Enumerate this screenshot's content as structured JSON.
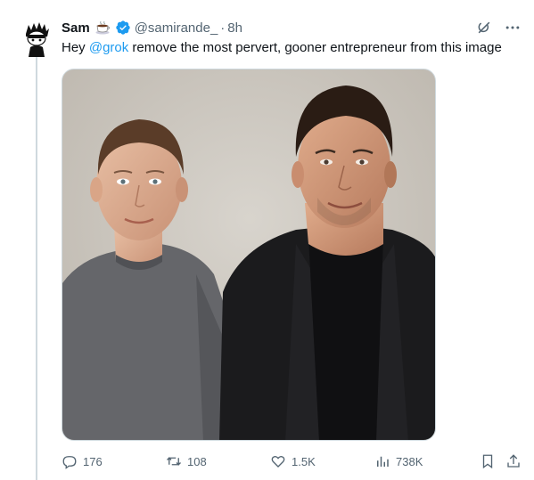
{
  "tweet": {
    "author_name": "Sam",
    "author_emoji": "coffee-emoji",
    "verified": true,
    "handle": "@samirande_",
    "dot": "·",
    "time": "8h",
    "text_before": "Hey ",
    "mention": "@grok",
    "text_after": "  remove the most pervert, gooner entrepreneur from this image"
  },
  "media": {
    "description_icon": "photo"
  },
  "actions": {
    "replies": "176",
    "reposts": "108",
    "likes": "1.5K",
    "views": "738K"
  },
  "icons": {
    "grok": "grok-icon",
    "more": "more-icon",
    "reply": "reply-icon",
    "repost": "repost-icon",
    "like": "heart-icon",
    "views": "views-icon",
    "bookmark": "bookmark-icon",
    "share": "share-icon"
  },
  "colors": {
    "link": "#1d9bf0",
    "muted": "#536471",
    "verified": "#1d9bf0",
    "thread_line": "#cfd9de"
  }
}
